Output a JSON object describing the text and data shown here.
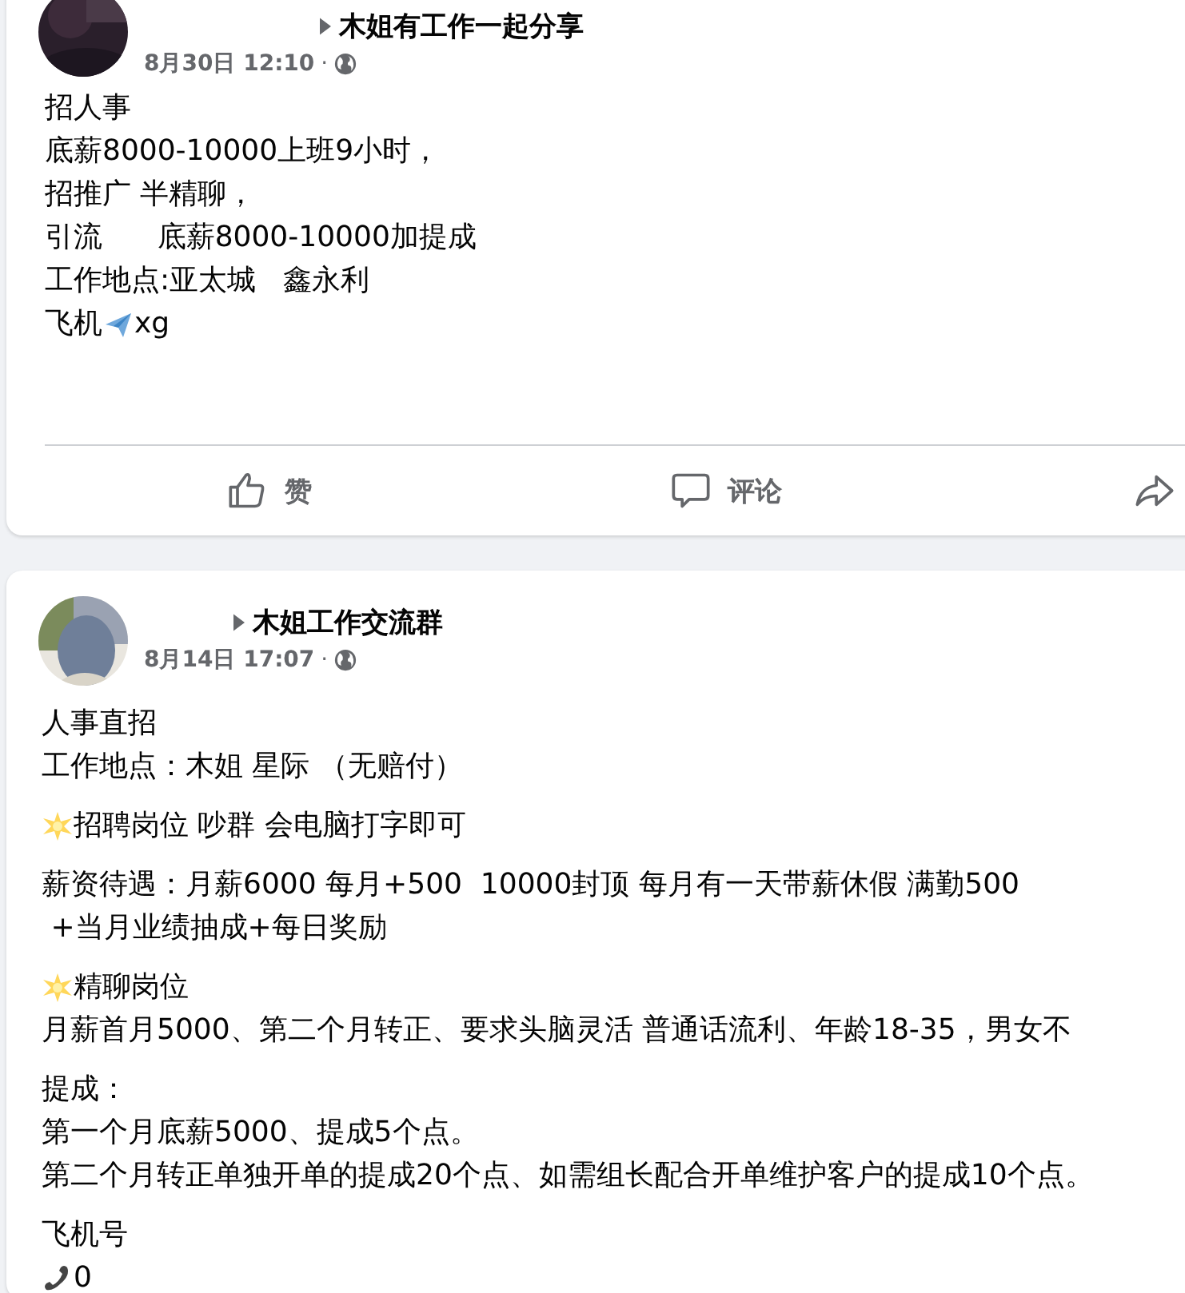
{
  "posts": [
    {
      "group": "木姐有工作一起分享",
      "time": "8月30日 12:10",
      "separator": "·",
      "paragraphs": [
        {
          "lines": [
            {
              "text": "招人事"
            },
            {
              "text": "底薪8000-10000上班9小时，"
            },
            {
              "text": "招推广 半精聊，"
            },
            {
              "text": "引流      底薪8000-10000加提成"
            },
            {
              "text": "工作地点:亚太城   鑫永利"
            },
            {
              "parts": [
                {
                  "kind": "text",
                  "text": "飞机"
                },
                {
                  "kind": "plane"
                },
                {
                  "kind": "text",
                  "text": "xg"
                }
              ]
            }
          ]
        }
      ],
      "actions": [
        {
          "kind": "like",
          "label": "赞"
        },
        {
          "kind": "comment",
          "label": "评论"
        },
        {
          "kind": "share"
        }
      ]
    },
    {
      "group": "木姐工作交流群",
      "time": "8月14日 17:07",
      "separator": "·",
      "paragraphs": [
        {
          "lines": [
            {
              "text": "人事直招"
            },
            {
              "text": "工作地点：木姐 星际 （无赔付）"
            }
          ]
        },
        {
          "lines": [
            {
              "kind": "star",
              "text": "招聘岗位 吵群 会电脑打字即可"
            }
          ]
        },
        {
          "lines": [
            {
              "text": "薪资待遇：月薪6000 每月+500  10000封顶 每月有一天带薪休假 满勤500"
            },
            {
              "text": " +当月业绩抽成+每日奖励"
            }
          ]
        },
        {
          "lines": [
            {
              "kind": "star",
              "text": "精聊岗位"
            },
            {
              "text": "月薪首月5000、第二个月转正、要求头脑灵活 普通话流利、年龄18-35，男女不"
            }
          ]
        },
        {
          "lines": [
            {
              "text": "提成："
            },
            {
              "text": "第一个月底薪5000、提成5个点。"
            },
            {
              "text": "第二个月转正单独开单的提成20个点、如需组长配合开单维护客户的提成10个点。"
            }
          ]
        },
        {
          "lines": [
            {
              "text": "飞机号"
            },
            {
              "kind": "phone",
              "text": "0"
            }
          ]
        }
      ]
    }
  ]
}
